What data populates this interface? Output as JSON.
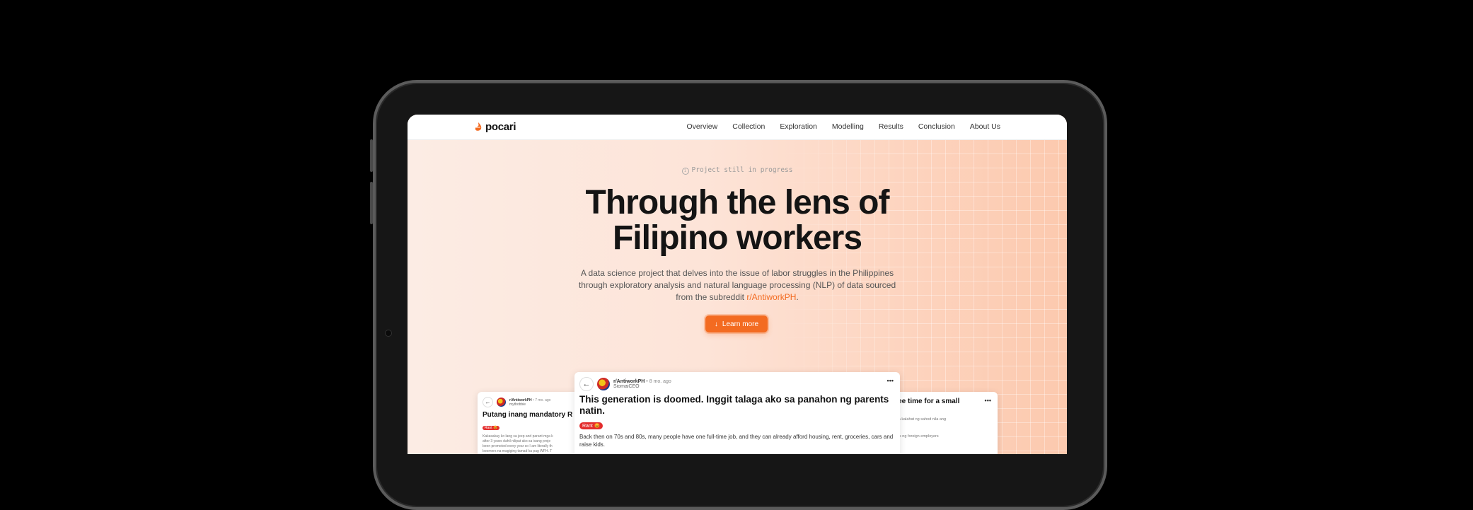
{
  "brand": {
    "name": "pocari",
    "accent": "#f36b21"
  },
  "nav": {
    "items": [
      "Overview",
      "Collection",
      "Exploration",
      "Modelling",
      "Results",
      "Conclusion",
      "About Us"
    ]
  },
  "hero": {
    "badge": "Project still in progress",
    "title_line1": "Through the lens of",
    "title_line2": "Filipino workers",
    "description": "A data science project that delves into the issue of labor struggles in the Philippines through exploratory analysis and natural language processing (NLP) of data sourced from the subreddit ",
    "subreddit_link": "r/AntiworkPH",
    "cta_label": "Learn more"
  },
  "posts": {
    "main": {
      "subreddit": "r/AntiworkPH",
      "age": "• 8 mo. ago",
      "user": "SiomaiCEO",
      "title": "This generation is doomed. Inggit talaga ako sa panahon ng parents natin.",
      "flair": "Rant 😡",
      "body": "Back then on 70s and 80s, many people have one full-time job, and they can already afford housing, rent, groceries, cars and raise kids."
    },
    "left": {
      "subreddit": "r/AntiworkPH",
      "age": "• 7 mo. ago",
      "user": "mytbobbie",
      "title": "Putang inang mandatory R",
      "flair": "Rant 😡",
      "body_lines": [
        "Kakasakay ko lang sa jeep and parant mga k",
        "after 3 years dahil nilipat ako sa isang proje",
        "been promoted every year so I am literally th",
        "boomers na magiging tamad ka pag WFH. T"
      ]
    },
    "right": {
      "title_line1": "ealth or free time for a small",
      "title_line2": "ary",
      "body_lines": [
        "man lang umabot sa kalahat ng sahod nila ang",
        "nce ang meron dito.",
        "",
        "dito. Pero ang profits ng foreign employers"
      ]
    }
  }
}
